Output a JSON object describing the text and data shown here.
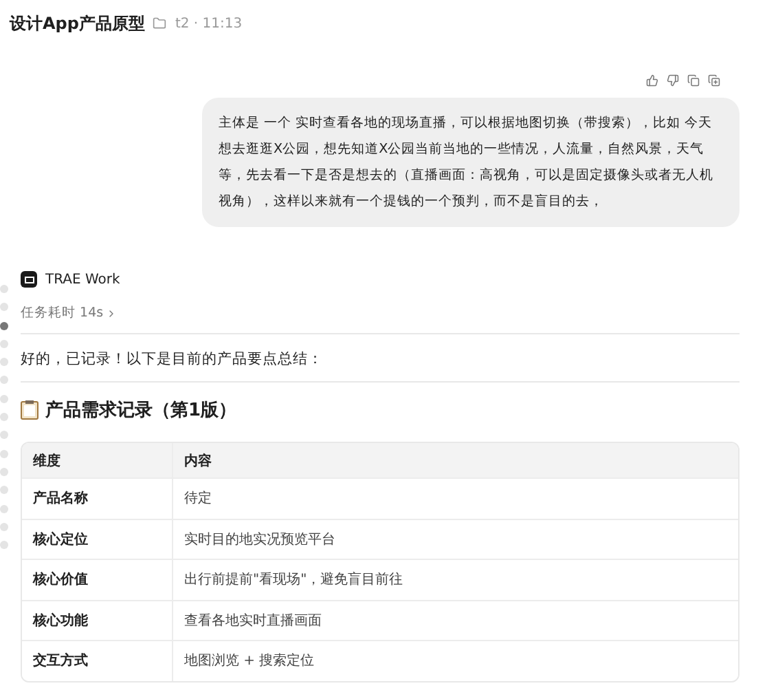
{
  "header": {
    "title": "设计App产品原型",
    "folder": "t2 · 11:13"
  },
  "user_message": {
    "text": "主体是 一个 实时查看各地的现场直播，可以根据地图切换（带搜索），比如 今天想去逛逛X公园，想先知道X公园当前当地的一些情况，人流量，自然风景，天气等，先去看一下是否是想去的（直播画面：高视角，可以是固定摄像头或者无人机视角），这样以来就有一个提钱的一个预判，而不是盲目的去，"
  },
  "timeline": [
    {
      "selected": false
    },
    {
      "selected": false
    },
    {
      "selected": true
    },
    {
      "selected": false
    },
    {
      "selected": false
    },
    {
      "selected": false
    },
    {
      "selected": false
    },
    {
      "selected": false
    },
    {
      "selected": false
    },
    {
      "selected": false
    },
    {
      "selected": false
    },
    {
      "selected": false
    },
    {
      "selected": false
    },
    {
      "selected": false
    },
    {
      "selected": false
    }
  ],
  "reply": {
    "agent": "TRAE Work",
    "duration": "任务耗时 14s",
    "intro": "好的，已记录！以下是目前的产品要点总结：",
    "heading": "产品需求记录（第1版）",
    "table": {
      "columns": [
        "维度",
        "内容"
      ],
      "rows": [
        [
          "产品名称",
          "待定"
        ],
        [
          "核心定位",
          "实时目的地实况预览平台"
        ],
        [
          "核心价值",
          "出行前提前\"看现场\"，避免盲目前往"
        ],
        [
          "核心功能",
          "查看各地实时直播画面"
        ],
        [
          "交互方式",
          "地图浏览 + 搜索定位"
        ]
      ]
    }
  }
}
